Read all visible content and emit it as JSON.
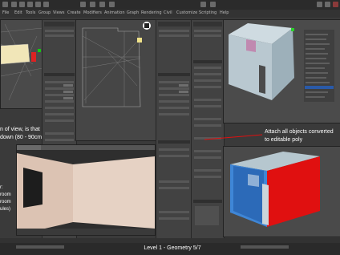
{
  "app": {
    "menu_items": [
      "File",
      "Edit",
      "Tools",
      "Group",
      "Views",
      "Create",
      "Modifiers",
      "Animation",
      "Graph",
      "Rendering",
      "Civil",
      "Customize",
      "Scripting",
      "Help"
    ]
  },
  "overlay": {
    "left_caption_lines": [
      "n of view, is that",
      "down (80 - 90cm)"
    ],
    "left_caption2_lines": [
      "r:",
      "room",
      "room",
      "ules)"
    ],
    "right_caption_lines": [
      "Attach all objects converted",
      "to editable poly"
    ]
  },
  "footer": {
    "caption": "Level 1 - Geometry 5/7"
  },
  "colors": {
    "viewport_bg": "#4a4a4a",
    "panel_bg": "#424242",
    "accent_red": "#e01010",
    "room_wall": "#b9c8d0",
    "room_pink": "#c089b0"
  }
}
